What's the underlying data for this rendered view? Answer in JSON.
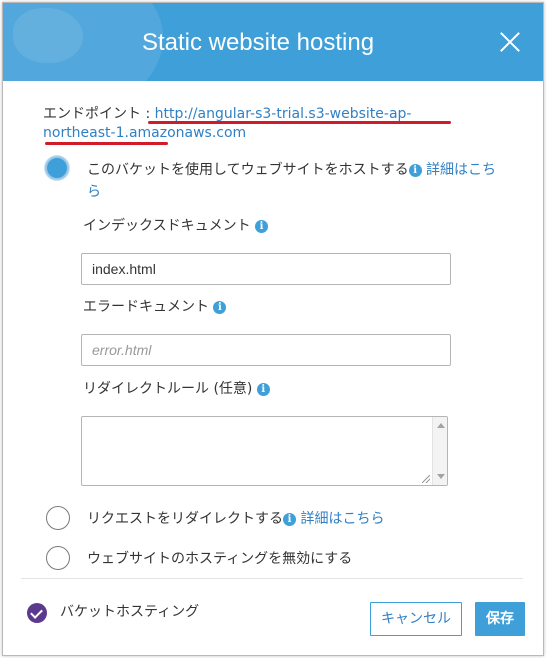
{
  "dialog": {
    "title": "Static website hosting",
    "endpoint_label": "エンドポイント : ",
    "endpoint_url": "http://angular-s3-trial.s3-website-ap-northeast-1.amazonaws.com"
  },
  "options": {
    "host": {
      "label": "このバケットを使用してウェブサイトをホストする",
      "link": "詳細はこちら",
      "selected": true
    },
    "redirect": {
      "label": "リクエストをリダイレクトする",
      "link": "詳細はこちら",
      "selected": false
    },
    "disable": {
      "label": "ウェブサイトのホスティングを無効にする",
      "selected": false
    }
  },
  "fields": {
    "index_label": "インデックスドキュメント",
    "index_value": "index.html",
    "error_label": "エラードキュメント",
    "error_placeholder": "error.html",
    "redirect_rules_label": "リダイレクトルール (任意)",
    "redirect_rules_value": ""
  },
  "footer": {
    "status_label": "バケットホスティング",
    "cancel_label": "キャンセル",
    "save_label": "保存"
  },
  "colors": {
    "header": "#3f9fd8",
    "link": "#3180c4",
    "annotation_underline": "#d11a2a",
    "status_check": "#5b3a8e"
  },
  "icons": {
    "info": "info-icon",
    "close": "close-icon",
    "check": "check-circle-icon"
  }
}
